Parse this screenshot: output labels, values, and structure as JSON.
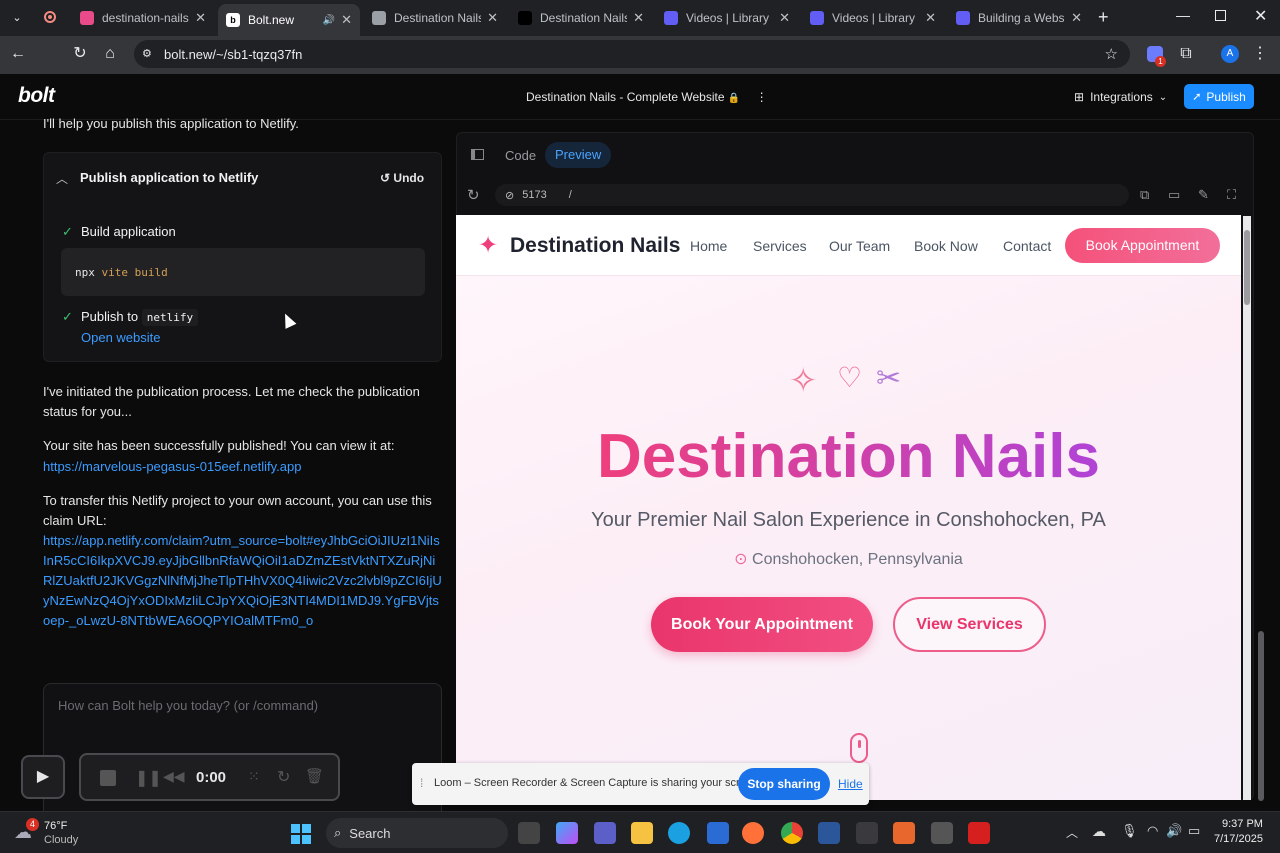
{
  "browser": {
    "tabs": [
      {
        "title": "destination-nails-a",
        "color": "#e94b8a"
      },
      {
        "title": "Bolt.new",
        "color": "#ffffff",
        "active": true
      },
      {
        "title": "Destination Nails -",
        "color": "#9aa0a6"
      },
      {
        "title": "Destination Nails W",
        "color": "#000000"
      },
      {
        "title": "Videos | Library | L",
        "color": "#625df5"
      },
      {
        "title": "Videos | Library | L",
        "color": "#625df5"
      },
      {
        "title": "Building a Website",
        "color": "#625df5"
      }
    ],
    "url": "bolt.new/~/sb1-tqzq37fn",
    "profile_initial": "A",
    "ext_badge": "1"
  },
  "bolt": {
    "logo": "bolt",
    "project_title": "Destination Nails - Complete Website",
    "integrations_label": "Integrations",
    "publish_label": "Publish"
  },
  "chat": {
    "top_line": "I'll help you publish this application to Netlify.",
    "action_title": "Publish application to Netlify",
    "undo_label": "Undo",
    "step1": "Build application",
    "step1_cmd_npx": "npx",
    "step1_cmd_rest": "vite build",
    "step2_prefix": "Publish to",
    "step2_target": "netlify",
    "open_website": "Open website",
    "msg1": "I've initiated the publication process. Let me check the publication status for you...",
    "msg2": "Your site has been successfully published! You can view it at:",
    "site_url": "https://marvelous-pegasus-015eef.netlify.app",
    "msg3": "To transfer this Netlify project to your own account, you can use  this claim URL:",
    "claim_url": "https://app.netlify.com/claim?utm_source=bolt#eyJhbGciOiJIUzI1NiIsInR5cCI6IkpXVCJ9.eyJjbGllbnRfaWQiOiI1aDZmZEstVktNTXZuRjNiRlZUaktfU2JKVGgzNlNfMjJheTlpTHhVX0Q4Iiwic2Vzc2lvbl9pZCI6IjUyNzEwNzQ4OjYxODIxMzIiLCJpYXQiOjE3NTI4MDI1MDJ9.YgFBVjtsoep-_oLwzU-8NTtbWEA6OQPYIOalMTFm0_o",
    "input_placeholder": "How can Bolt help you today? (or /command)"
  },
  "preview": {
    "tab_code": "Code",
    "tab_preview": "Preview",
    "port": "5173",
    "path": "/",
    "site": {
      "brand": "Destination Nails",
      "nav": [
        "Home",
        "Services",
        "Our Team",
        "Book Now",
        "Contact"
      ],
      "cta": "Book Appointment",
      "hero_title": "Destination Nails",
      "hero_subtitle": "Your Premier Nail Salon Experience in Conshohocken, PA",
      "location": "Conshohocken, Pennsylvania",
      "btn_primary": "Book Your Appointment",
      "btn_secondary": "View Services"
    }
  },
  "recorder": {
    "timer": "0:00"
  },
  "loom": {
    "message": "Loom – Screen Recorder & Screen Capture is sharing your screen.",
    "stop_label": "Stop sharing",
    "hide_label": "Hide"
  },
  "taskbar": {
    "temp": "76°F",
    "weather": "Cloudy",
    "weather_badge": "4",
    "search_label": "Search",
    "time": "9:37 PM",
    "date": "7/17/2025"
  }
}
